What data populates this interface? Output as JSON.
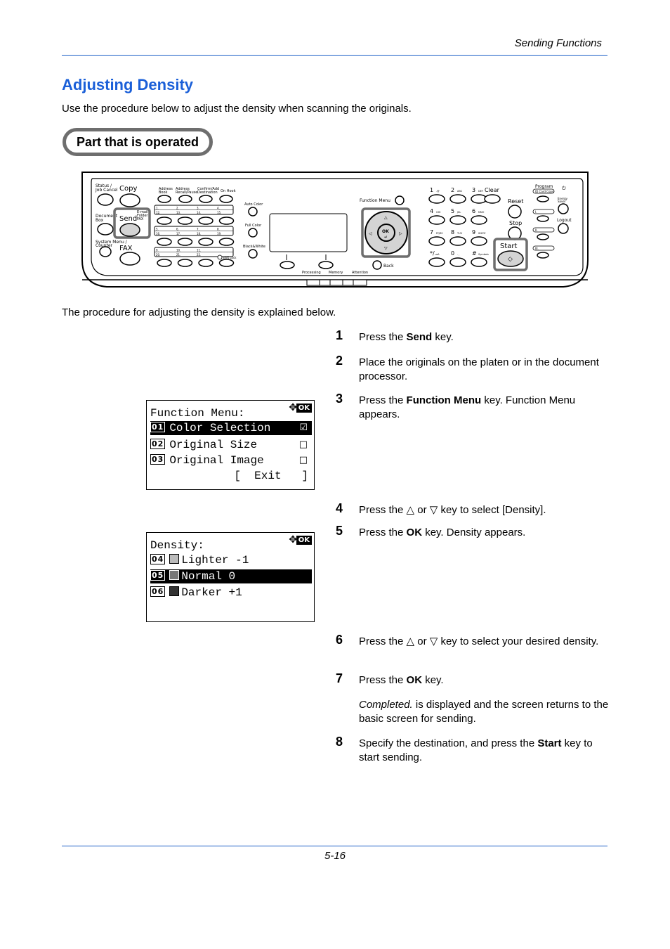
{
  "header": {
    "section": "Sending Functions"
  },
  "title": "Adjusting Density",
  "intro": "Use the procedure below to adjust the density when scanning the originals.",
  "part_label": "Part that is operated",
  "panel": {
    "left_keys": [
      "Status / Job Cancel",
      "Copy",
      "Document Box",
      "Send",
      "System Menu / Counter",
      "FAX"
    ],
    "send_sub": [
      "E-mail",
      "Folder",
      "FAX"
    ],
    "top_keys": [
      "Address Book",
      "Address Recall/Pause",
      "Confirm/Add Destination",
      "On Hook"
    ],
    "one_touch_rows": [
      [
        "1.",
        "2.",
        "3.",
        "4."
      ],
      [
        "12.",
        "13.",
        "14.",
        "15."
      ],
      [
        "5.",
        "6.",
        "7.",
        "8."
      ],
      [
        "16.",
        "17.",
        "18.",
        "19."
      ],
      [
        "9.",
        "10.",
        "11."
      ],
      [
        "20.",
        "21.",
        "22."
      ]
    ],
    "shift_lock": "Shift Lock",
    "color_keys": [
      "Auto Color",
      "Full Color",
      "Black&White"
    ],
    "function_menu": "Function Menu",
    "ok_key": "OK",
    "back": "Back",
    "indicators": [
      "Processing",
      "Memory",
      "Attention"
    ],
    "numpad": [
      [
        "1",
        ".@"
      ],
      [
        "2",
        "ABC"
      ],
      [
        "3",
        "DEF"
      ],
      [
        "4",
        "GHI"
      ],
      [
        "5",
        "JKL"
      ],
      [
        "6",
        "MNO"
      ],
      [
        "7",
        "PQRS"
      ],
      [
        "8",
        "TUV"
      ],
      [
        "9",
        "WXYZ"
      ],
      [
        "*/.",
        "aA"
      ],
      [
        "0",
        ". ,"
      ],
      [
        "#",
        "Symbols"
      ]
    ],
    "clear": "Clear",
    "reset": "Reset",
    "stop": "Stop",
    "start": "Start",
    "program": "Program",
    "program_sub": "ID Card Copy",
    "program_slots": [
      "I.",
      "II.",
      "III."
    ],
    "energy_saver": "Energy Saver",
    "logout": "Logout"
  },
  "explain": "The procedure for adjusting the density is explained below.",
  "steps": [
    {
      "num": "1",
      "pre": "Press the ",
      "bold": "Send",
      "post": " key."
    },
    {
      "num": "2",
      "pre": "Place the originals on the platen or in the document processor.",
      "bold": "",
      "post": ""
    },
    {
      "num": "3",
      "pre": "Press the ",
      "bold": "Function Menu",
      "post": " key. Function Menu appears."
    },
    {
      "num": "4",
      "pre": "Press the △ or ▽ key to select [Density].",
      "bold": "",
      "post": ""
    },
    {
      "num": "5",
      "pre": "Press the ",
      "bold": "OK",
      "post": " key. Density appears."
    },
    {
      "num": "6",
      "pre": "Press the △ or ▽ key to select your desired density.",
      "bold": "",
      "post": ""
    },
    {
      "num": "7",
      "pre": "Press the ",
      "bold": "OK",
      "post": " key."
    },
    {
      "num": "8",
      "pre": "Specify the destination, and press the ",
      "bold": "Start",
      "post": " key to start sending."
    }
  ],
  "step7_note": {
    "italic": "Completed.",
    "rest": " is displayed and the screen returns to the basic screen for sending."
  },
  "screen1": {
    "title": "Function Menu:",
    "ok": "OK",
    "nav_icon": "✥",
    "items": [
      {
        "badge": "01",
        "label": "Color Selection",
        "mark": "☑",
        "selected": true
      },
      {
        "badge": "02",
        "label": "Original Size",
        "mark": "□",
        "selected": false
      },
      {
        "badge": "03",
        "label": "Original Image",
        "mark": "□",
        "selected": false
      }
    ],
    "exit": "[  Exit   ]"
  },
  "screen2": {
    "title": "Density:",
    "ok": "OK",
    "nav_icon": "✥",
    "items": [
      {
        "badge": "04",
        "label": "Lighter -1",
        "selected": false
      },
      {
        "badge": "05",
        "label": "Normal 0",
        "selected": true
      },
      {
        "badge": "06",
        "label": "Darker +1",
        "selected": false
      }
    ]
  },
  "footer": {
    "page": "5-16"
  },
  "colors": {
    "accent": "#1a5fd8",
    "rule": "#1c5fc6",
    "highlight_border": "#6e6e6e"
  }
}
